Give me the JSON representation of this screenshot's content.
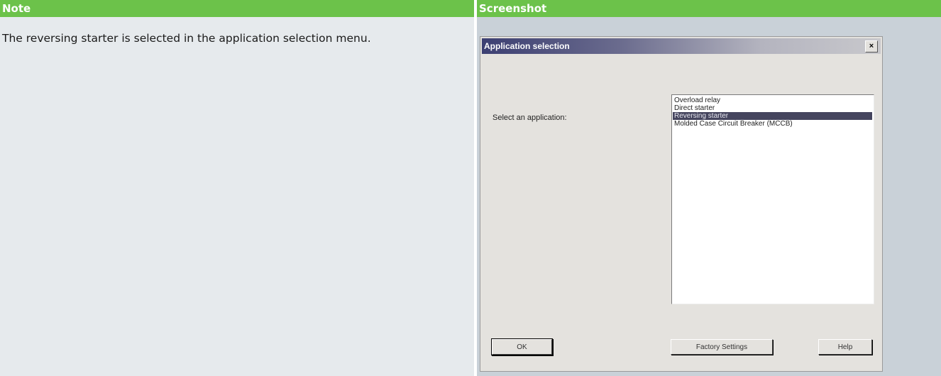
{
  "header": {
    "note_label": "Note",
    "screenshot_label": "Screenshot"
  },
  "note": {
    "text": "The reversing starter is selected in the application selection menu."
  },
  "dialog": {
    "title": "Application selection",
    "close_glyph": "×",
    "select_label": "Select an application:",
    "applications": [
      "Overload relay",
      "Direct starter",
      "Reversing starter",
      "Molded Case Circuit Breaker (MCCB)"
    ],
    "selected_index": 2,
    "buttons": {
      "ok": "OK",
      "factory": "Factory Settings",
      "help": "Help"
    }
  },
  "colors": {
    "header_green": "#6cc24a",
    "note_bg": "#e6eaed",
    "selected_item_bg": "#45455e"
  }
}
